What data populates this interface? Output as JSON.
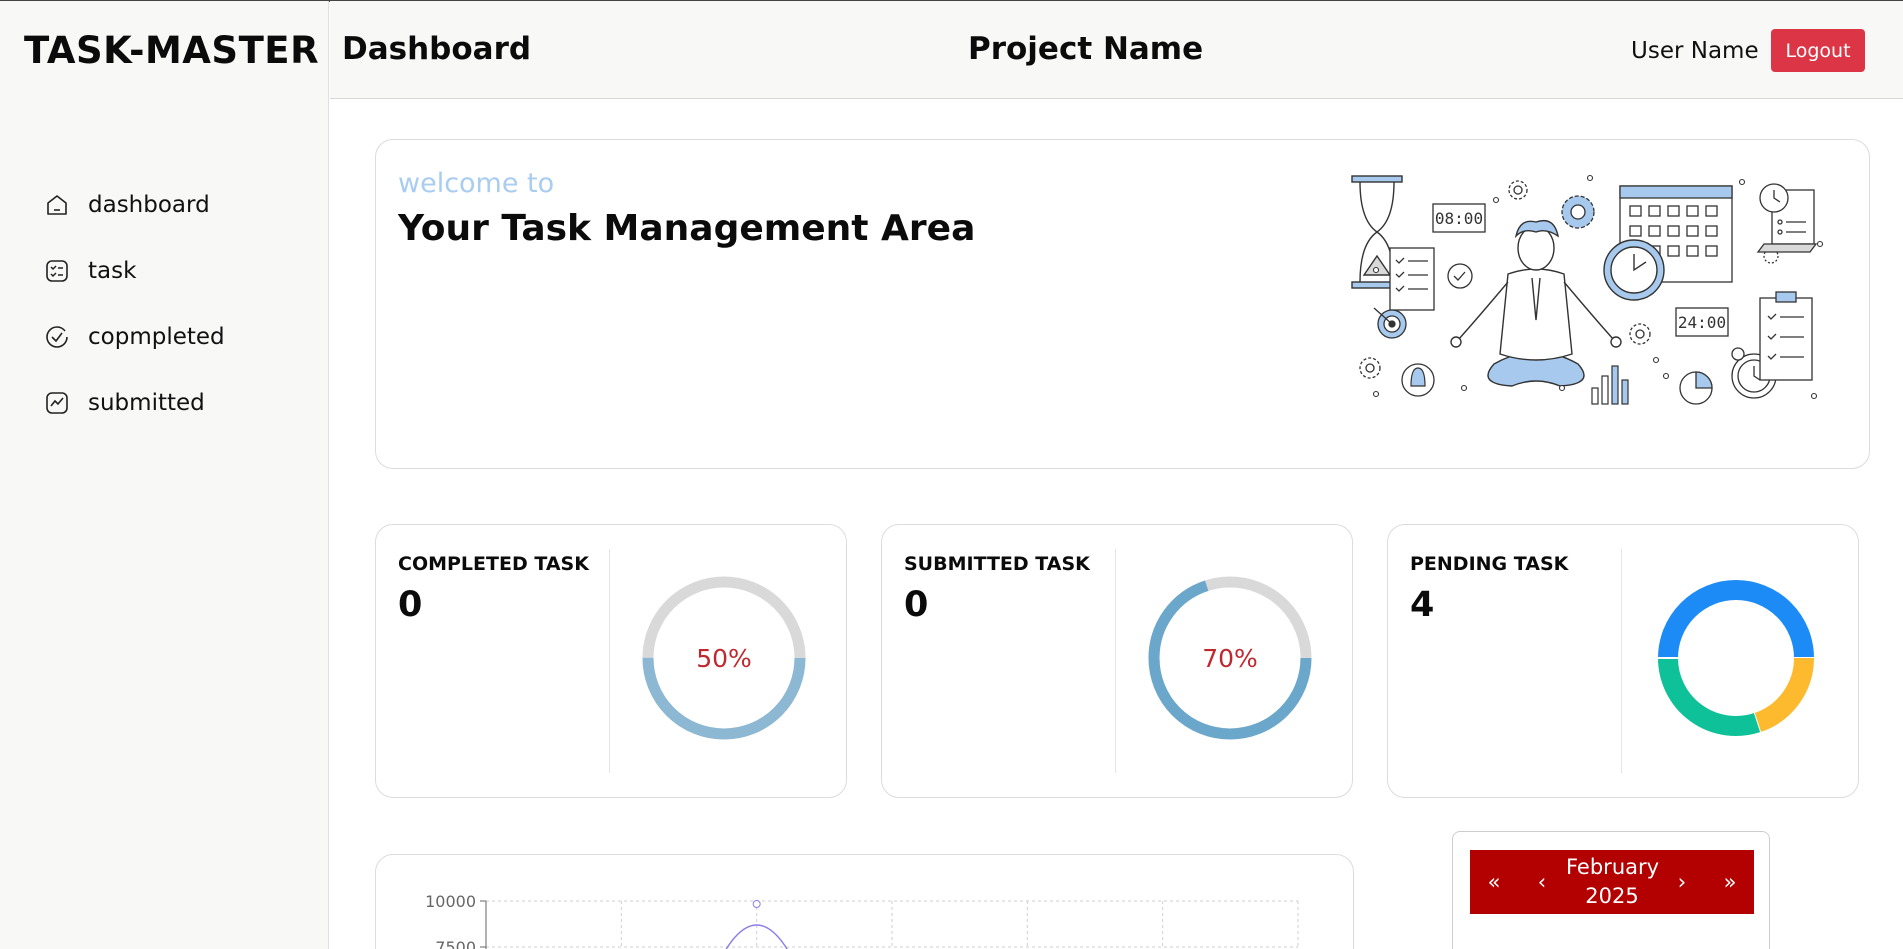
{
  "brand": {
    "logo": "TASK-MASTER"
  },
  "sidebar": {
    "items": [
      {
        "label": "dashboard",
        "icon": "home-icon"
      },
      {
        "label": "task",
        "icon": "checklist-icon"
      },
      {
        "label": "copmpleted",
        "icon": "check-circle-icon"
      },
      {
        "label": "submitted",
        "icon": "chart-icon"
      }
    ]
  },
  "header": {
    "title": "Dashboard",
    "project": "Project Name",
    "user": "User Name",
    "logout_label": "Logout"
  },
  "welcome": {
    "small": "welcome to",
    "title": "Your Task Management Area",
    "illustration_clock1": "08:00",
    "illustration_clock2": "24:00"
  },
  "stats": [
    {
      "title": "COMPLETED TASK",
      "value": "0",
      "percent_label": "50%",
      "percent": 50,
      "ring_color": "#8cb8d3"
    },
    {
      "title": "SUBMITTED TASK",
      "value": "0",
      "percent_label": "70%",
      "percent": 70,
      "ring_color": "#6aa7cb"
    },
    {
      "title": "PENDING TASK",
      "value": "4"
    }
  ],
  "chart_data": [
    {
      "type": "pie",
      "title": "",
      "slices": [
        {
          "value": 50,
          "color": "#1c8bf6"
        },
        {
          "value": 20,
          "color": "#fdba2f"
        },
        {
          "value": 30,
          "color": "#0fc198"
        }
      ]
    },
    {
      "type": "line",
      "title": "",
      "y_ticks": [
        "10000",
        "7500"
      ],
      "ylim": [
        0,
        10000
      ],
      "grid": true,
      "series": [
        {
          "color": "#8a7fe6",
          "peak": 10000
        }
      ]
    }
  ],
  "calendar": {
    "prev_year": "«",
    "prev_month": "‹",
    "month": "February",
    "year": "2025",
    "next_month": "›",
    "next_year": "»"
  }
}
